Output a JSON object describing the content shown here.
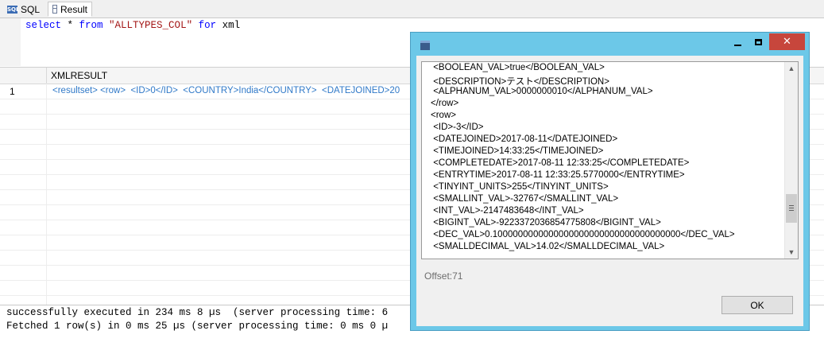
{
  "tabs": [
    {
      "label": "SQL",
      "icon": "sql-icon"
    },
    {
      "label": "Result",
      "icon": "grid-icon",
      "active": true
    }
  ],
  "editor": {
    "select": "select",
    "star": " * ",
    "from": "from",
    "table": " \"ALLTYPES_COL\" ",
    "for": "for",
    "xml": " xml"
  },
  "grid": {
    "column_header": "XMLRESULT",
    "rows": [
      {
        "num": "1",
        "value": "<resultset> <row>  <ID>0</ID>  <COUNTRY>India</COUNTRY>  <DATEJOINED>20"
      }
    ]
  },
  "console": {
    "line1": "successfully executed in 234 ms 8 µs  (server processing time: 6",
    "line2": "Fetched 1 row(s) in 0 ms 25 µs (server processing time: 0 ms 0 µ"
  },
  "dialog": {
    "window_icon": "app-icon",
    "xml_lines": [
      " <BOOLEAN_VAL>true</BOOLEAN_VAL>",
      " <DESCRIPTION>テスト</DESCRIPTION>",
      " <ALPHANUM_VAL>0000000010</ALPHANUM_VAL>",
      "</row>",
      "<row>",
      " <ID>-3</ID>",
      " <DATEJOINED>2017-08-11</DATEJOINED>",
      " <TIMEJOINED>14:33:25</TIMEJOINED>",
      " <COMPLETEDATE>2017-08-11 12:33:25</COMPLETEDATE>",
      " <ENTRYTIME>2017-08-11 12:33:25.5770000</ENTRYTIME>",
      " <TINYINT_UNITS>255</TINYINT_UNITS>",
      " <SMALLINT_VAL>-32767</SMALLINT_VAL>",
      " <INT_VAL>-2147483648</INT_VAL>",
      " <BIGINT_VAL>-9223372036854775808</BIGINT_VAL>",
      " <DEC_VAL>0.1000000000000000000000000000000000000</DEC_VAL>",
      " <SMALLDECIMAL_VAL>14.02</SMALLDECIMAL_VAL>"
    ],
    "offset_label": "Offset:71",
    "ok_label": "OK"
  }
}
